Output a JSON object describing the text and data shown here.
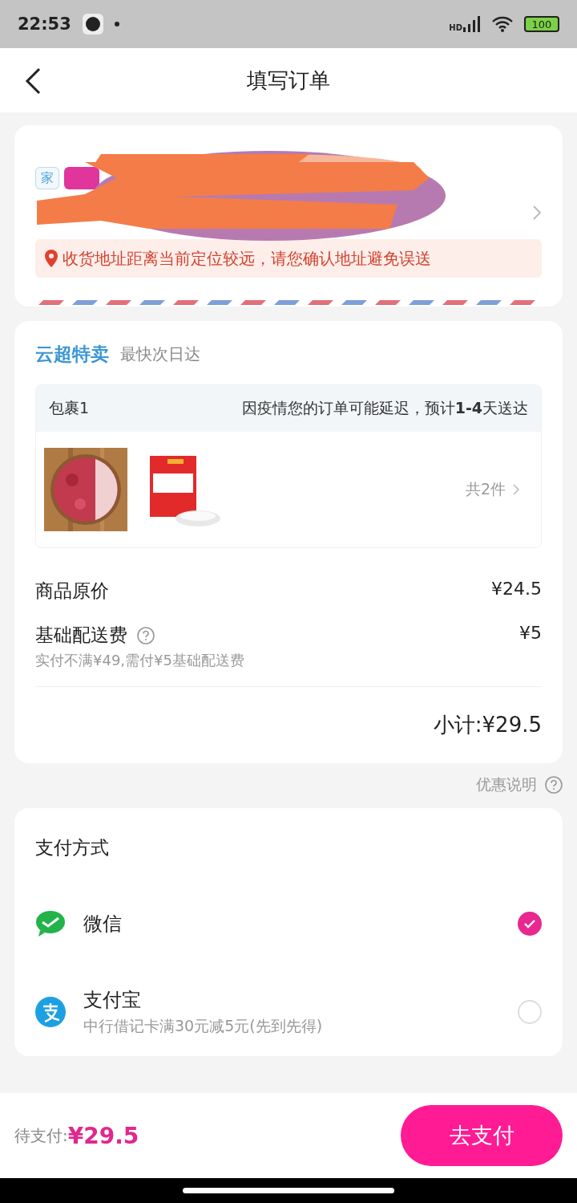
{
  "status_bar": {
    "time": "22:53",
    "network": "HD",
    "battery": "100"
  },
  "header": {
    "title": "填写订单"
  },
  "address": {
    "tags": [
      {
        "label": "家",
        "color": "#4aa3d8"
      },
      {
        "color": "#e0359a"
      }
    ],
    "redacted": true,
    "warning": "收货地址距离当前定位较远，请您确认地址避免误送"
  },
  "shipment": {
    "store": "云超特卖",
    "eta": "最快次日达",
    "package": {
      "name": "包裹1",
      "notice": "因疫情您的订单可能延迟，预计**1-4**天送达",
      "count": "共2件"
    },
    "fees": [
      {
        "label": "商品原价",
        "amount": "¥24.5",
        "help": false
      },
      {
        "label": "基础配送费",
        "amount": "¥5",
        "help": true,
        "note": "实付不满¥49,需付¥5基础配送费"
      }
    ],
    "subtotal": "小计:¥29.5"
  },
  "discount_note": "优惠说明",
  "payment": {
    "title": "支付方式",
    "methods": [
      {
        "kind": "wechat",
        "name": "微信",
        "selected": true
      },
      {
        "kind": "alipay",
        "name": "支付宝",
        "note": "中行借记卡满30元减5元(先到先得)",
        "selected": false
      }
    ]
  },
  "footer": {
    "label": "待支付:",
    "amount": "¥29.5",
    "button": "去支付"
  }
}
